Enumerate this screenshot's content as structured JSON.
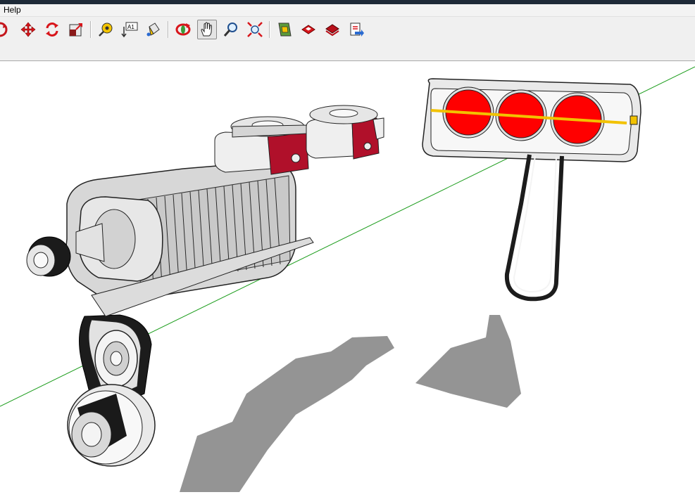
{
  "menubar": {
    "items": [
      {
        "label": "Help"
      }
    ]
  },
  "toolbar": {
    "tools": [
      {
        "name": "orbit-partial",
        "icon": "orbit-icon"
      },
      {
        "name": "move",
        "icon": "move-icon"
      },
      {
        "name": "rotate",
        "icon": "rotate-icon"
      },
      {
        "name": "scale",
        "icon": "scale-icon"
      },
      {
        "name": "tape-measure",
        "icon": "tape-measure-icon"
      },
      {
        "name": "text",
        "icon": "text-icon",
        "label": "A1"
      },
      {
        "name": "paint-bucket",
        "icon": "paint-bucket-icon"
      },
      {
        "name": "orbit",
        "icon": "orbit-icon"
      },
      {
        "name": "pan",
        "icon": "pan-hand-icon",
        "active": true
      },
      {
        "name": "zoom",
        "icon": "zoom-icon"
      },
      {
        "name": "zoom-extents",
        "icon": "zoom-extents-icon"
      },
      {
        "name": "warehouse",
        "icon": "warehouse-icon"
      },
      {
        "name": "components",
        "icon": "components-icon"
      },
      {
        "name": "share-model",
        "icon": "share-model-icon"
      },
      {
        "name": "export",
        "icon": "export-icon"
      }
    ]
  },
  "scene": {
    "axis_color": "#1a9c1a",
    "shadow_color": "#949494",
    "red_light_color": "#ff0000",
    "bar_color": "#f2c200",
    "metal_color": "#d6d6d6",
    "accent_red": "#b0102a"
  }
}
